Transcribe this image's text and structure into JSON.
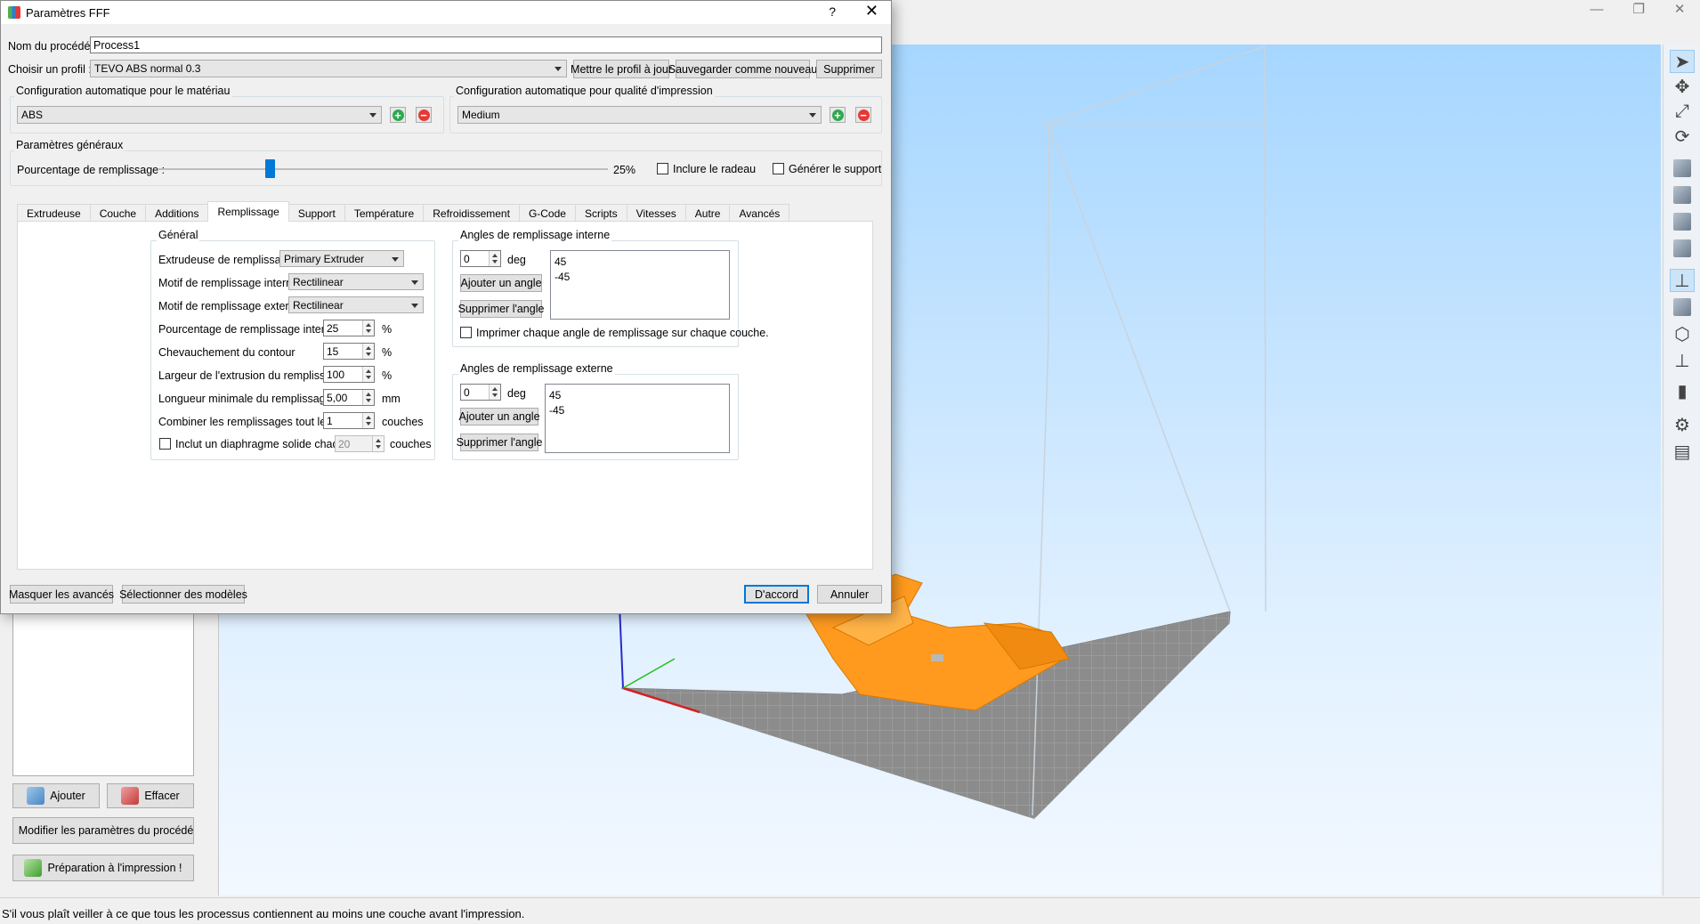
{
  "window": {
    "title": "Paramètres FFF",
    "help": "?",
    "close": "✕",
    "app_controls": [
      "—",
      "❐",
      "✕"
    ]
  },
  "process": {
    "name_label": "Nom du procédé :",
    "name_value": "Process1",
    "profile_label": "Choisir un profil :",
    "profile_value": "TEVO ABS normal 0.3",
    "update_button": "Mettre le profil à jour",
    "save_new_button": "Sauvegarder comme nouveau",
    "delete_button": "Supprimer"
  },
  "auto_material": {
    "title": "Configuration automatique pour le matériau",
    "value": "ABS"
  },
  "auto_quality": {
    "title": "Configuration automatique pour qualité d'impression",
    "value": "Medium"
  },
  "general": {
    "title": "Paramètres généraux",
    "fill_label": "Pourcentage de remplissage :",
    "fill_value": "25%",
    "fill_fraction": 0.25,
    "raft_label": "Inclure le radeau",
    "support_label": "Générer le support"
  },
  "tabs": [
    "Extrudeuse",
    "Couche",
    "Additions",
    "Remplissage",
    "Support",
    "Température",
    "Refroidissement",
    "G-Code",
    "Scripts",
    "Vitesses",
    "Autre",
    "Avancés"
  ],
  "selected_tab": "Remplissage",
  "infill": {
    "group_title": "Général",
    "extruder_label": "Extrudeuse de remplissage",
    "extruder_value": "Primary Extruder",
    "inner_pattern_label": "Motif de remplissage interne",
    "inner_pattern_value": "Rectilinear",
    "outer_pattern_label": "Motif de remplissage externe",
    "outer_pattern_value": "Rectilinear",
    "inner_pct_label": "Pourcentage de remplissage interne",
    "inner_pct_value": "25",
    "overlap_label": "Chevauchement du contour",
    "overlap_value": "15",
    "width_label": "Largeur de l'extrusion du remplissage",
    "width_value": "100",
    "min_len_label": "Longueur minimale du remplissage",
    "min_len_value": "5,00",
    "combine_label": "Combiner les remplissages tout les",
    "combine_value": "1",
    "diaphragm_label": "Inclut un diaphragme solide chaque",
    "diaphragm_value": "20",
    "unit_pct": "%",
    "unit_mm": "mm",
    "unit_layers": "couches"
  },
  "inner_angles": {
    "title": "Angles de remplissage interne",
    "value": "0",
    "unit": "deg",
    "add": "Ajouter un angle",
    "remove": "Supprimer l'angle",
    "list": [
      "45",
      "-45"
    ],
    "print_each_label": "Imprimer chaque angle de remplissage sur chaque couche."
  },
  "outer_angles": {
    "title": "Angles de remplissage externe",
    "value": "0",
    "unit": "deg",
    "add": "Ajouter un angle",
    "remove": "Supprimer l'angle",
    "list": [
      "45",
      "-45"
    ]
  },
  "footer": {
    "hide_advanced": "Masquer les avancés",
    "select_models": "Sélectionner des modèles",
    "ok": "D'accord",
    "cancel": "Annuler"
  },
  "side_panel": {
    "add": "Ajouter",
    "clear": "Effacer",
    "edit_process": "Modifier les paramètres du procédé",
    "prepare": "Préparation à l'impression !"
  },
  "status": "S'il vous plaît veiller à ce que tous les processus contiennent au moins une couche avant l'impression.",
  "colors": {
    "accent": "#0078d7",
    "model": "#ff9a1f",
    "bed": "#8c8c8c",
    "sky": "#a6d6ff"
  }
}
